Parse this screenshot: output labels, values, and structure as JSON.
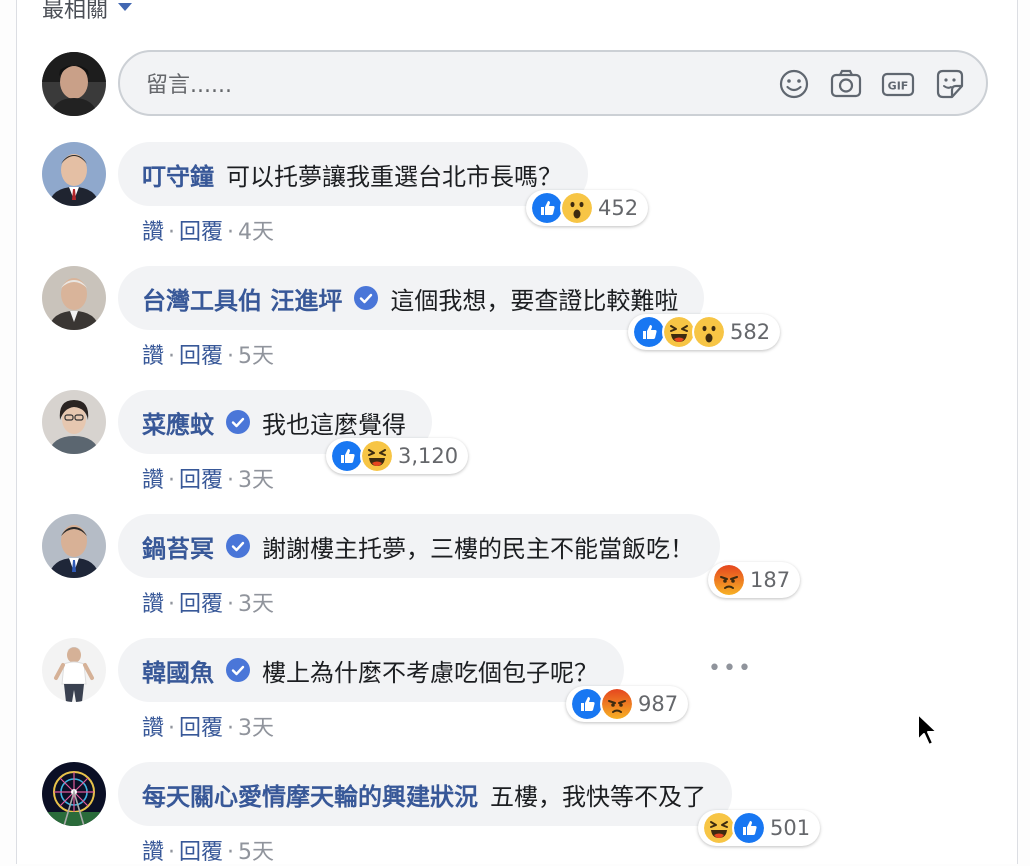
{
  "sort_label": "最相關",
  "composer": {
    "placeholder": "留言......",
    "icons": [
      "emoji-icon",
      "camera-icon",
      "gif-icon",
      "sticker-icon"
    ],
    "gif_text": "GIF"
  },
  "comments": [
    {
      "author": "叮守鐘",
      "verified": false,
      "text": "可以托夢讓我重選台北市長嗎？",
      "reactions": [
        "like",
        "wow"
      ],
      "count": "452",
      "like": "讚",
      "reply": "回覆",
      "time": "4天"
    },
    {
      "author": "台灣工具伯 汪進坪",
      "verified": true,
      "text": "這個我想，要查證比較難啦",
      "reactions": [
        "like",
        "haha",
        "wow"
      ],
      "count": "582",
      "like": "讚",
      "reply": "回覆",
      "time": "5天"
    },
    {
      "author": "菜應蚊",
      "verified": true,
      "text": "我也這麼覺得",
      "reactions": [
        "like",
        "haha"
      ],
      "count": "3,120",
      "like": "讚",
      "reply": "回覆",
      "time": "3天"
    },
    {
      "author": "鍋苔冥",
      "verified": true,
      "text": "謝謝樓主托夢，三樓的民主不能當飯吃！",
      "reactions": [
        "angry"
      ],
      "count": "187",
      "like": "讚",
      "reply": "回覆",
      "time": "3天"
    },
    {
      "author": "韓國魚",
      "verified": true,
      "text": "樓上為什麼不考慮吃個包子呢？",
      "reactions": [
        "like",
        "angry"
      ],
      "count": "987",
      "like": "讚",
      "reply": "回覆",
      "time": "3天"
    },
    {
      "author": "每天關心愛情摩天輪的興建狀況",
      "verified": false,
      "text": "五樓，我快等不及了",
      "reactions": [
        "haha",
        "like"
      ],
      "count": "501",
      "like": "讚",
      "reply": "回覆",
      "time": "5天"
    }
  ],
  "more_options": "•••",
  "colors": {
    "link": "#385898",
    "bubble": "#f2f3f5",
    "like": "#1877f2",
    "emoji": "#f7c545",
    "angry": "#e5461f"
  }
}
